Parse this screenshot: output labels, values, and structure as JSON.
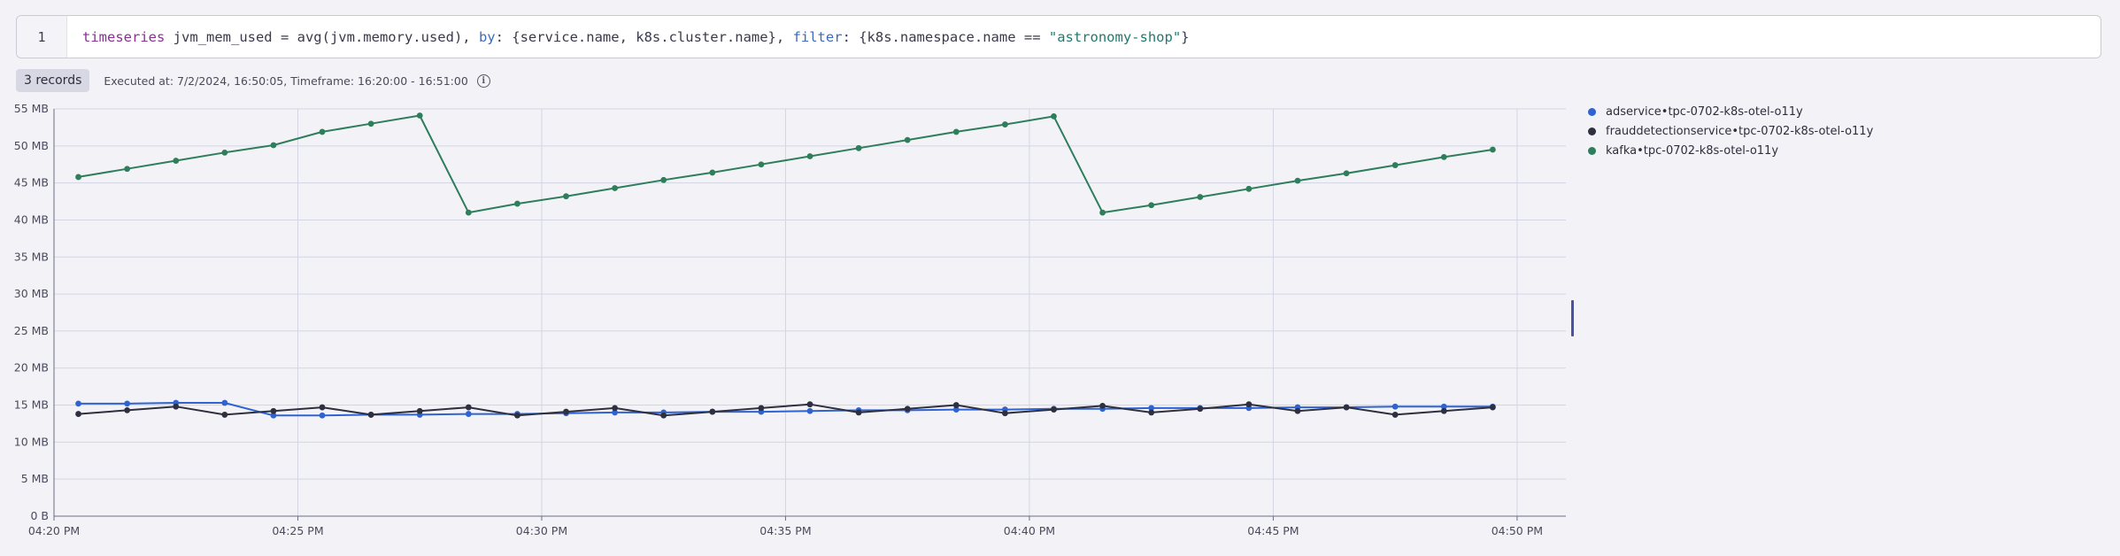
{
  "editor": {
    "line_number": "1",
    "tokens": [
      {
        "t": "timeseries",
        "c": "kw"
      },
      {
        "t": " jvm_mem_used = avg(jvm.memory.used), ",
        "c": ""
      },
      {
        "t": "by",
        "c": "param"
      },
      {
        "t": ": {service.name, k8s.cluster.name}, ",
        "c": ""
      },
      {
        "t": "filter",
        "c": "param"
      },
      {
        "t": ": {k8s.namespace.name == ",
        "c": ""
      },
      {
        "t": "\"astronomy-shop\"",
        "c": "str"
      },
      {
        "t": "}",
        "c": ""
      }
    ]
  },
  "status": {
    "records": "3 records",
    "executed": "Executed at: 7/2/2024, 16:50:05, Timeframe: 16:20:00 - 16:51:00",
    "info_icon": "info-icon"
  },
  "chart_data": {
    "type": "line",
    "ylim": [
      0,
      55
    ],
    "yticks": [
      0,
      5,
      10,
      15,
      20,
      25,
      30,
      35,
      40,
      45,
      50,
      55
    ],
    "ytick_labels": [
      "0 B",
      "5 MB",
      "10 MB",
      "15 MB",
      "20 MB",
      "25 MB",
      "30 MB",
      "35 MB",
      "40 MB",
      "45 MB",
      "50 MB",
      "55 MB"
    ],
    "xlim": [
      "16:20",
      "16:51"
    ],
    "xticks": [
      "16:20",
      "16:25",
      "16:30",
      "16:35",
      "16:40",
      "16:45",
      "16:50"
    ],
    "xtick_labels": [
      "04:20 PM",
      "04:25 PM",
      "04:30 PM",
      "04:35 PM",
      "04:40 PM",
      "04:45 PM",
      "04:50 PM"
    ],
    "x": [
      "16:20:30",
      "16:21:30",
      "16:22:30",
      "16:23:30",
      "16:24:30",
      "16:25:30",
      "16:26:30",
      "16:27:30",
      "16:28:30",
      "16:29:30",
      "16:30:30",
      "16:31:30",
      "16:32:30",
      "16:33:30",
      "16:34:30",
      "16:35:30",
      "16:36:30",
      "16:37:30",
      "16:38:30",
      "16:39:30",
      "16:40:30",
      "16:41:30",
      "16:42:30",
      "16:43:30",
      "16:44:30",
      "16:45:30",
      "16:46:30",
      "16:47:30",
      "16:48:30",
      "16:49:30"
    ],
    "grid": true,
    "legend_position": "right",
    "series": [
      {
        "name": "adservice•tpc-0702-k8s-otel-o11y",
        "color": "#2f63d1",
        "values": [
          15.2,
          15.2,
          15.3,
          15.3,
          13.6,
          13.6,
          13.7,
          13.7,
          13.8,
          13.8,
          13.9,
          14.0,
          14.0,
          14.1,
          14.1,
          14.2,
          14.3,
          14.3,
          14.4,
          14.4,
          14.5,
          14.5,
          14.6,
          14.6,
          14.6,
          14.7,
          14.7,
          14.8,
          14.8,
          14.8
        ]
      },
      {
        "name": "frauddetectionservice•tpc-0702-k8s-otel-o11y",
        "color": "#2e2f3f",
        "values": [
          13.8,
          14.3,
          14.8,
          13.7,
          14.2,
          14.7,
          13.7,
          14.2,
          14.7,
          13.6,
          14.1,
          14.6,
          13.6,
          14.1,
          14.6,
          15.1,
          14.0,
          14.5,
          15.0,
          13.9,
          14.4,
          14.9,
          14.0,
          14.5,
          15.1,
          14.2,
          14.7,
          13.7,
          14.2,
          14.7
        ]
      },
      {
        "name": "kafka•tpc-0702-k8s-otel-o11y",
        "color": "#2e7d5b",
        "values": [
          45.8,
          46.9,
          48.0,
          49.1,
          50.1,
          51.9,
          53.0,
          54.1,
          41.0,
          42.2,
          43.2,
          44.3,
          45.4,
          46.4,
          47.5,
          48.6,
          49.7,
          50.8,
          51.9,
          52.9,
          54.0,
          41.0,
          42.0,
          43.1,
          44.2,
          45.3,
          46.3,
          47.4,
          48.5,
          49.5
        ]
      }
    ]
  }
}
